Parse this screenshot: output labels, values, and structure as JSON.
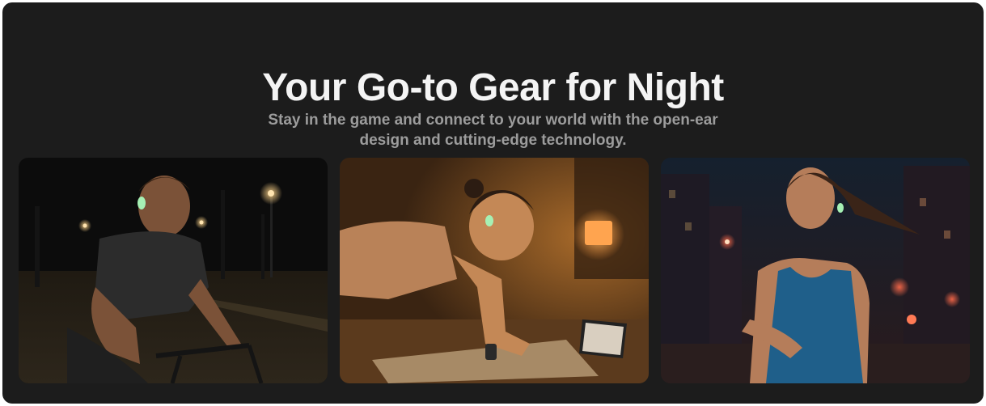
{
  "hero": {
    "title": "Your Go-to Gear for Night",
    "subtitle": "Stay in the game and connect to your world with the open-ear design and cutting-edge technology."
  },
  "cards": [
    {
      "scene": "cyclist-night-park"
    },
    {
      "scene": "plank-workout-home"
    },
    {
      "scene": "runner-city-night"
    }
  ],
  "colors": {
    "background": "#1c1c1c",
    "title": "#f4f4f4",
    "subtitle": "#9c9c9c",
    "earbud_glow": "#a6f0b4"
  }
}
